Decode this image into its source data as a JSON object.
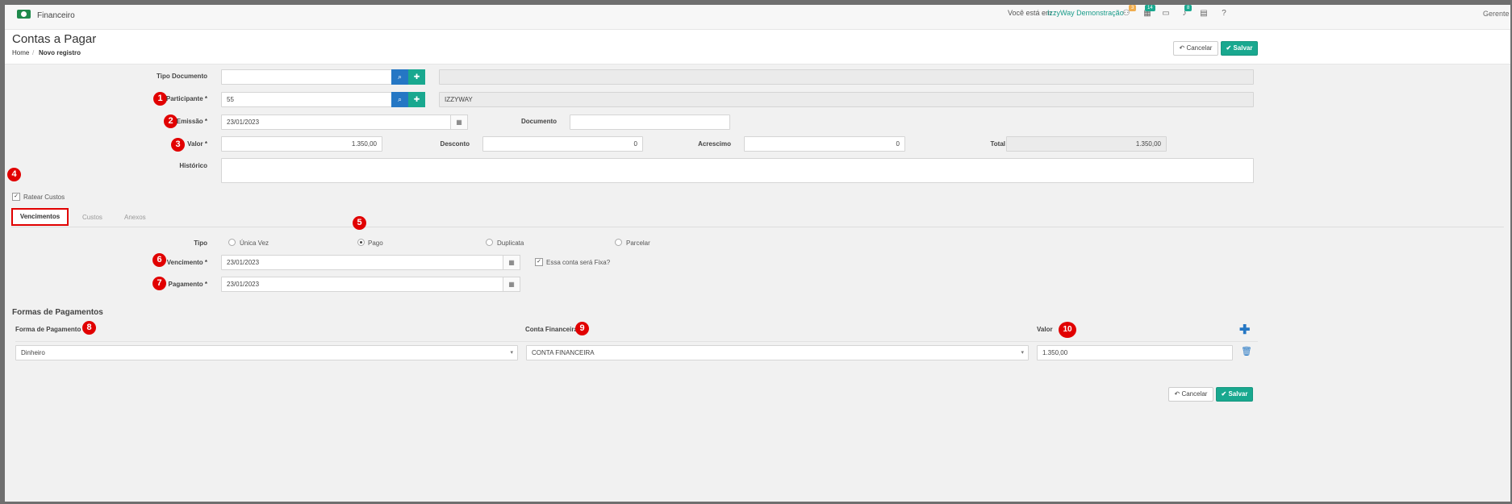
{
  "app": {
    "name": "Financeiro",
    "you_are_label": "Você está em :",
    "company": "IzzyWay Demonstração",
    "user": "Gerente"
  },
  "topbar_icons": [
    {
      "name": "network-icon",
      "glyph": "⚇",
      "badge": "3",
      "badge_color": "#f0ad4e"
    },
    {
      "name": "tasks-icon",
      "glyph": "▦",
      "badge": "14",
      "badge_color": "#19a88f"
    },
    {
      "name": "card-icon",
      "glyph": "▭",
      "badge": "",
      "badge_color": ""
    },
    {
      "name": "bell-icon",
      "glyph": "♪",
      "badge": "8",
      "badge_color": "#19a88f"
    },
    {
      "name": "calendar-icon",
      "glyph": "▤",
      "badge": "",
      "badge_color": ""
    },
    {
      "name": "help-icon",
      "glyph": "?",
      "badge": "",
      "badge_color": ""
    }
  ],
  "header": {
    "title": "Contas a Pagar",
    "breadcrumb_home": "Home",
    "breadcrumb_sep": "/",
    "breadcrumb_current": "Novo registro"
  },
  "actions": {
    "cancel": "Cancelar",
    "save": "Salvar"
  },
  "form": {
    "tipo_documento": {
      "label": "Tipo Documento",
      "value": "",
      "description": ""
    },
    "participante": {
      "label": "Participante *",
      "value": "55",
      "description": "IZZYWAY"
    },
    "emissao": {
      "label": "Emissão *",
      "value": "23/01/2023"
    },
    "documento": {
      "label": "Documento",
      "value": ""
    },
    "valor": {
      "label": "Valor *",
      "value": "1.350,00"
    },
    "desconto": {
      "label": "Desconto",
      "value": "0"
    },
    "acrescimo": {
      "label": "Acrescimo",
      "value": "0"
    },
    "total": {
      "label": "Total",
      "value": "1.350,00"
    },
    "historico": {
      "label": "Histórico",
      "value": ""
    },
    "ratear_custos": {
      "label": "Ratear Custos",
      "checked": true
    }
  },
  "tabs": [
    {
      "label": "Vencimentos",
      "active": true
    },
    {
      "label": "Custos",
      "active": false
    },
    {
      "label": "Anexos",
      "active": false
    }
  ],
  "vencimentos": {
    "tipo_label": "Tipo",
    "tipo_options": [
      {
        "label": "Única Vez",
        "selected": false
      },
      {
        "label": "Pago",
        "selected": true
      },
      {
        "label": "Duplicata",
        "selected": false
      },
      {
        "label": "Parcelar",
        "selected": false
      }
    ],
    "vencimento": {
      "label": "Vencimento *",
      "value": "23/01/2023"
    },
    "fixa": {
      "label": "Essa conta será Fixa?",
      "checked": true
    },
    "pagamento": {
      "label": "Pagamento *",
      "value": "23/01/2023"
    }
  },
  "formas": {
    "title": "Formas de Pagamentos",
    "col_forma": "Forma de Pagamento",
    "col_conta": "Conta Financeira",
    "col_valor": "Valor",
    "row": {
      "forma": "Dinheiro",
      "conta": "CONTA FINANCEIRA",
      "valor": "1.350,00"
    }
  },
  "markers": [
    "1",
    "2",
    "3",
    "4",
    "5",
    "6",
    "7",
    "8",
    "9",
    "10"
  ]
}
